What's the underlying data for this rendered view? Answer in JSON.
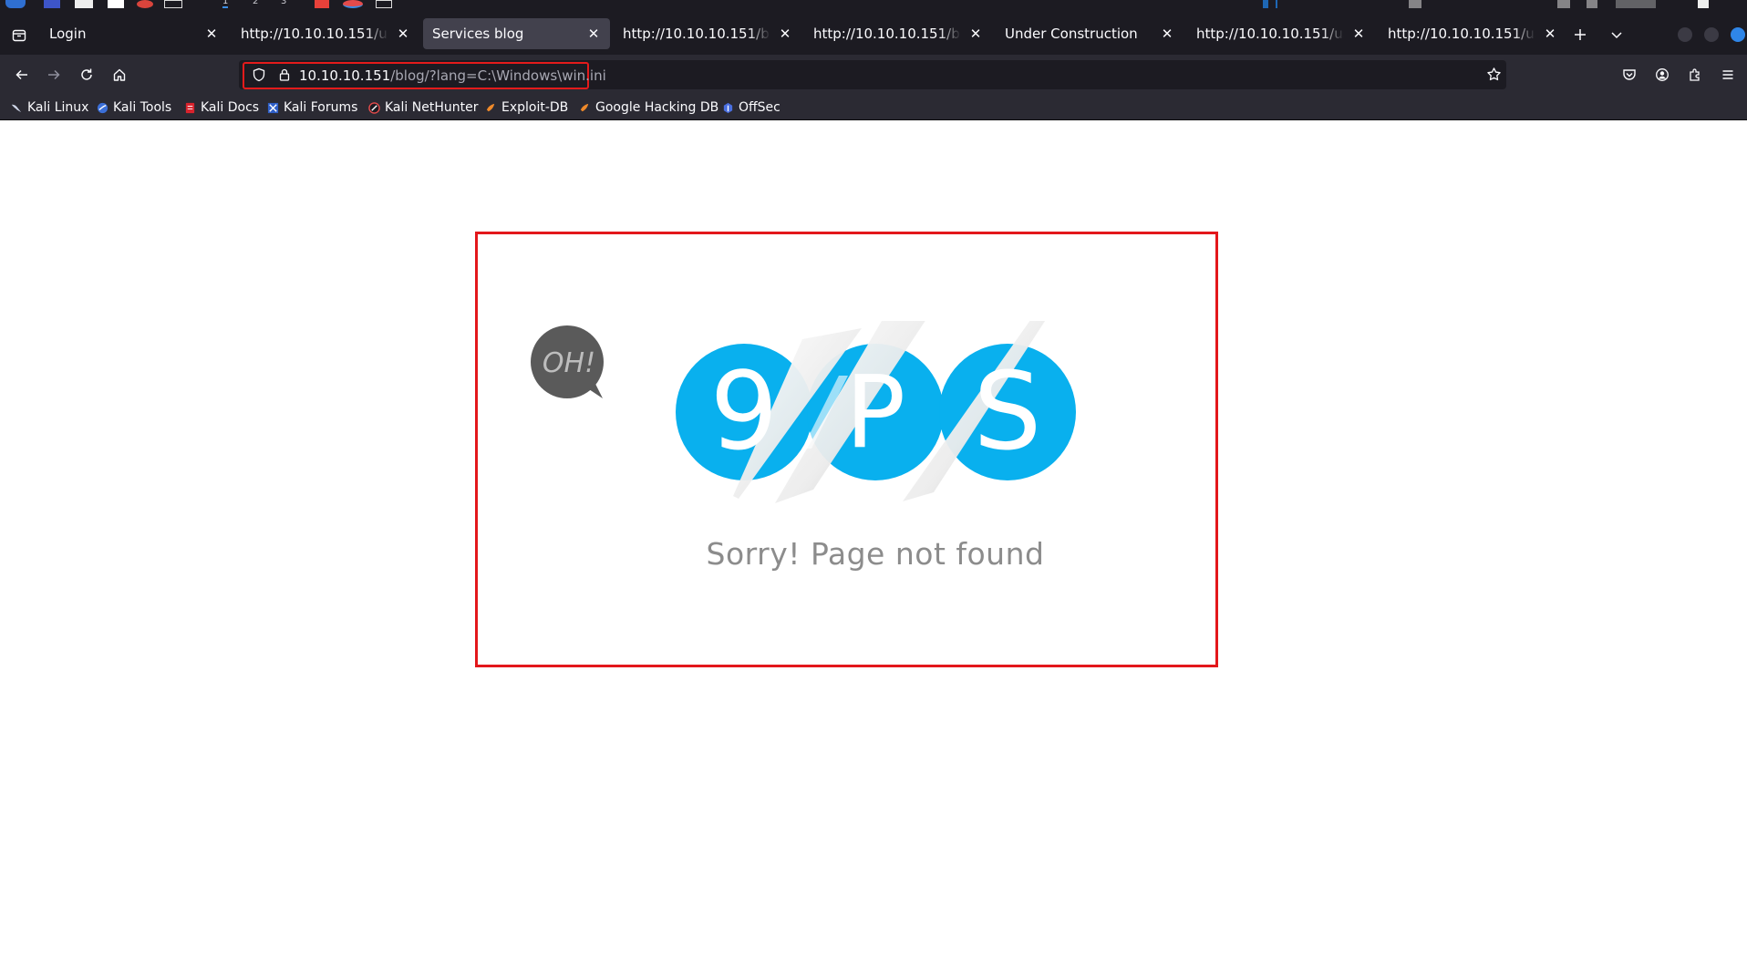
{
  "os_panel": {
    "workspaces": [
      "1",
      "2",
      "3"
    ]
  },
  "tabs": [
    {
      "title": "Login",
      "active": false
    },
    {
      "title": "http://10.10.10.151/user/lo",
      "active": false
    },
    {
      "title": "Services blog",
      "active": true
    },
    {
      "title": "http://10.10.10.151/blog/?l",
      "active": false
    },
    {
      "title": "http://10.10.10.151/blog/?l",
      "active": false
    },
    {
      "title": "Under Construction",
      "active": false
    },
    {
      "title": "http://10.10.10.151/user/lo",
      "active": false
    },
    {
      "title": "http://10.10.10.151/user/in",
      "active": false
    }
  ],
  "urlbar": {
    "host": "10.10.10.151",
    "path": "/blog/?lang=C:\\Windows\\win.ini"
  },
  "bookmarks": [
    {
      "label": "Kali Linux",
      "icon": "kali-dragon-icon"
    },
    {
      "label": "Kali Tools",
      "icon": "kali-tools-icon"
    },
    {
      "label": "Kali Docs",
      "icon": "kali-docs-icon"
    },
    {
      "label": "Kali Forums",
      "icon": "kali-forums-icon"
    },
    {
      "label": "Kali NetHunter",
      "icon": "nethunter-icon"
    },
    {
      "label": "Exploit-DB",
      "icon": "exploit-db-icon"
    },
    {
      "label": "Google Hacking DB",
      "icon": "ghdb-icon"
    },
    {
      "label": "OffSec",
      "icon": "offsec-icon"
    }
  ],
  "page": {
    "bubble_text": "OH!",
    "logo_letters": [
      "9",
      "P",
      "S"
    ],
    "message": "Sorry! Page not found"
  },
  "colors": {
    "chrome_dark": "#1c1b22",
    "toolbar": "#2b2a33",
    "active_tab": "#42414d",
    "highlight_red": "#e3171b",
    "logo_blue": "#09b0ee",
    "bubble_gray": "#5a5a5a",
    "message_gray": "#8c8c8c"
  }
}
